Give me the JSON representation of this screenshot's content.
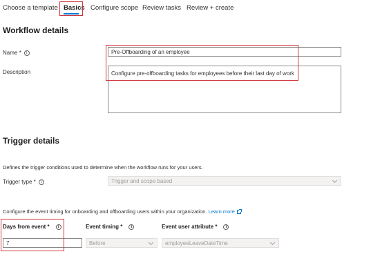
{
  "tabs": [
    {
      "label": "Choose a template"
    },
    {
      "label": "Basics"
    },
    {
      "label": "Configure scope"
    },
    {
      "label": "Review tasks"
    },
    {
      "label": "Review + create"
    }
  ],
  "active_tab": "Basics",
  "workflow_details": {
    "heading": "Workflow details",
    "name_label": "Name *",
    "name_value": "Pre-Offboarding of an employee",
    "description_label": "Description",
    "description_value": "Configure pre-offboarding tasks for employees before their last day of work"
  },
  "trigger_details": {
    "heading": "Trigger details",
    "intro": "Defines the trigger conditions used to determine when the workflow runs for your users.",
    "trigger_type_label": "Trigger type *",
    "trigger_type_value": "Trigger and scope based",
    "event_timing_text": "Configure the event timing for onboarding and offboarding users within your organization.",
    "learn_more": "Learn more",
    "days_from_event_label": "Days from event *",
    "days_from_event_value": "7",
    "event_timing_label": "Event timing *",
    "event_timing_value": "Before",
    "event_user_attribute_label": "Event user attribute *",
    "event_user_attribute_value": "employeeLeaveDateTime"
  },
  "colors": {
    "accent": "#0078d4",
    "highlight": "#d13438"
  }
}
